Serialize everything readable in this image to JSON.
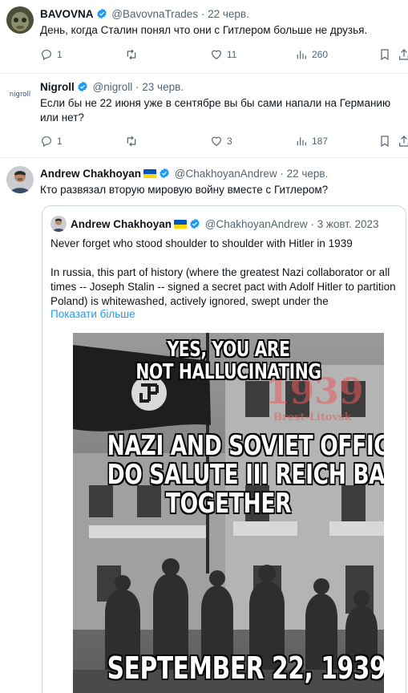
{
  "tweets": [
    {
      "name": "BAVOVNA",
      "handle": "@BavovnaTrades",
      "date": "22 черв.",
      "text": "День, когда Сталин понял что они с Гитлером больше не друзья.",
      "actions": {
        "replies": "1",
        "retweets": "",
        "likes": "11",
        "views": "260"
      }
    },
    {
      "name": "Nigroll",
      "handle": "@nigroll",
      "date": "23 черв.",
      "avatar_text": "nigroll",
      "text": "Если бы не 22 июня уже в сентябре вы бы сами напали на Германию или нет?",
      "actions": {
        "replies": "1",
        "retweets": "",
        "likes": "3",
        "views": "187"
      }
    },
    {
      "name": "Andrew Chakhoyan",
      "handle": "@ChakhoyanAndrew",
      "date": "22 черв.",
      "text": "Кто развязал вторую мировую войну вместе с Гитлером?"
    }
  ],
  "quote": {
    "name": "Andrew Chakhoyan",
    "handle": "@ChakhoyanAndrew",
    "date": "3 жовт. 2023",
    "line1": "Never forget who stood shoulder to shoulder with Hitler in 1939",
    "line2": "In russia, this part of history (where the greatest Nazi collaborator or all times -- Joseph Stalin -- signed a secret pact with Adolf Hitler to partition Poland) is whitewashed, actively ignored, swept under the",
    "show_more": "Показати більше",
    "meme": {
      "cap1": "YES, YOU ARE",
      "cap2": "NOT HALLUCINATING",
      "year": "1939",
      "place": "Brest-Litovsk",
      "cap3": "NAZI AND SOVIET OFFICERS",
      "cap4": "DO SALUTE III REICH BANNER",
      "cap5": "TOGETHER",
      "cap6": "SEPTEMBER 22, 1939"
    }
  },
  "colors": {
    "verified": "#1d9bf0",
    "link": "#1d9bf0",
    "muted": "#536471",
    "flag_blue": "#0057b7",
    "flag_yellow": "#ffd700"
  },
  "icons": [
    "reply-icon",
    "retweet-icon",
    "like-icon",
    "views-icon",
    "bookmark-icon",
    "share-icon",
    "verified-icon"
  ]
}
